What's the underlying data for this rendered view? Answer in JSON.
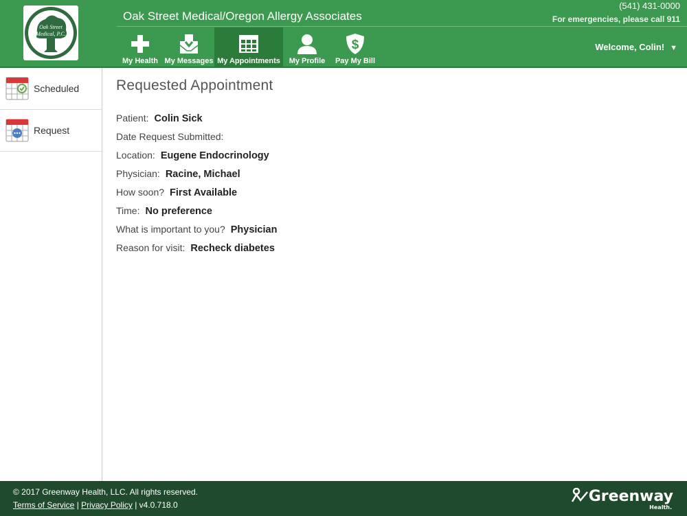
{
  "header": {
    "logo_text_line1": "Oak Street",
    "logo_text_line2": "Medical, P.C.",
    "practice_name": "Oak Street Medical/Oregon Allergy Associates",
    "phone": "(541) 431-0000",
    "emergency": "For emergencies, please call 911",
    "welcome": "Welcome, Colin!",
    "nav": [
      {
        "label": "My Health",
        "icon": "plus-icon",
        "active": false
      },
      {
        "label": "My Messages",
        "icon": "inbox-icon",
        "active": false
      },
      {
        "label": "My Appointments",
        "icon": "calendar-icon",
        "active": true
      },
      {
        "label": "My Profile",
        "icon": "person-icon",
        "active": false
      },
      {
        "label": "Pay My Bill",
        "icon": "dollar-shield-icon",
        "active": false
      }
    ]
  },
  "sidebar": {
    "items": [
      {
        "label": "Scheduled",
        "icon": "calendar-check-icon"
      },
      {
        "label": "Request",
        "icon": "calendar-dots-icon"
      }
    ]
  },
  "main": {
    "title": "Requested Appointment",
    "fields": [
      {
        "label": "Patient:",
        "value": "Colin Sick"
      },
      {
        "label": "Date Request Submitted:",
        "value": ""
      },
      {
        "label": "Location:",
        "value": "Eugene Endocrinology"
      },
      {
        "label": "Physician:",
        "value": "Racine, Michael"
      },
      {
        "label": "How soon?",
        "value": "First Available"
      },
      {
        "label": "Time:",
        "value": "No preference"
      },
      {
        "label": "What is important to you?",
        "value": "Physician"
      },
      {
        "label": "Reason for visit:",
        "value": "Recheck diabetes"
      }
    ]
  },
  "footer": {
    "copyright": "© 2017 Greenway Health, LLC. All rights reserved.",
    "terms": "Terms of Service",
    "privacy": "Privacy Policy",
    "version": "| v4.0.718.0",
    "separator": "|",
    "brand": "Greenway",
    "brand_sub": "Health."
  },
  "colors": {
    "header_green": "#3c9a50",
    "active_nav_green": "#2b7b3a",
    "footer_green": "#1f4a2b"
  }
}
